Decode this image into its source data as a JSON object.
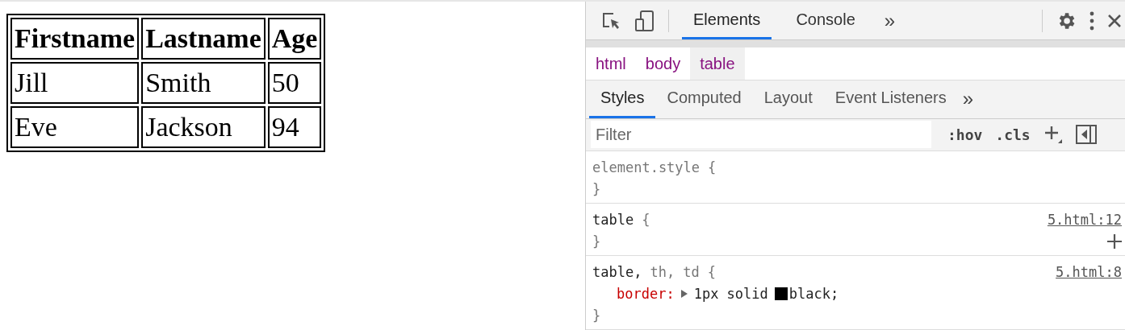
{
  "page_table": {
    "columns": [
      "Firstname",
      "Lastname",
      "Age"
    ],
    "rows": [
      [
        "Jill",
        "Smith",
        "50"
      ],
      [
        "Eve",
        "Jackson",
        "94"
      ]
    ]
  },
  "devtools": {
    "tabs": [
      {
        "label": "Elements",
        "selected": true
      },
      {
        "label": "Console",
        "selected": false
      }
    ],
    "more_tabs": "»",
    "breadcrumbs": [
      {
        "label": "html",
        "selected": false
      },
      {
        "label": "body",
        "selected": false
      },
      {
        "label": "table",
        "selected": true
      }
    ],
    "panel_tabs": [
      {
        "label": "Styles",
        "selected": true
      },
      {
        "label": "Computed",
        "selected": false
      },
      {
        "label": "Layout",
        "selected": false
      },
      {
        "label": "Event Listeners",
        "selected": false
      }
    ],
    "more_panel_tabs": "»",
    "filter": {
      "placeholder": "Filter"
    },
    "toggles": [
      ":hov",
      ".cls"
    ],
    "rules": [
      {
        "selectors": [
          {
            "text": "element.style",
            "matched": false
          }
        ],
        "open": "{",
        "close": "}"
      },
      {
        "selectors": [
          {
            "text": "table",
            "matched": true
          }
        ],
        "open": "{",
        "close": "}",
        "source": "5.html:12",
        "add_button": true
      },
      {
        "selectors": [
          {
            "text": "table,",
            "matched": true
          },
          {
            "text": "th,",
            "matched": false
          },
          {
            "text": "td",
            "matched": false
          }
        ],
        "open": "{",
        "close": "}",
        "source": "5.html:8",
        "declarations": [
          {
            "property": "border:",
            "value": "1px solid",
            "color": "#000000",
            "keyword": "black;"
          }
        ]
      }
    ]
  }
}
